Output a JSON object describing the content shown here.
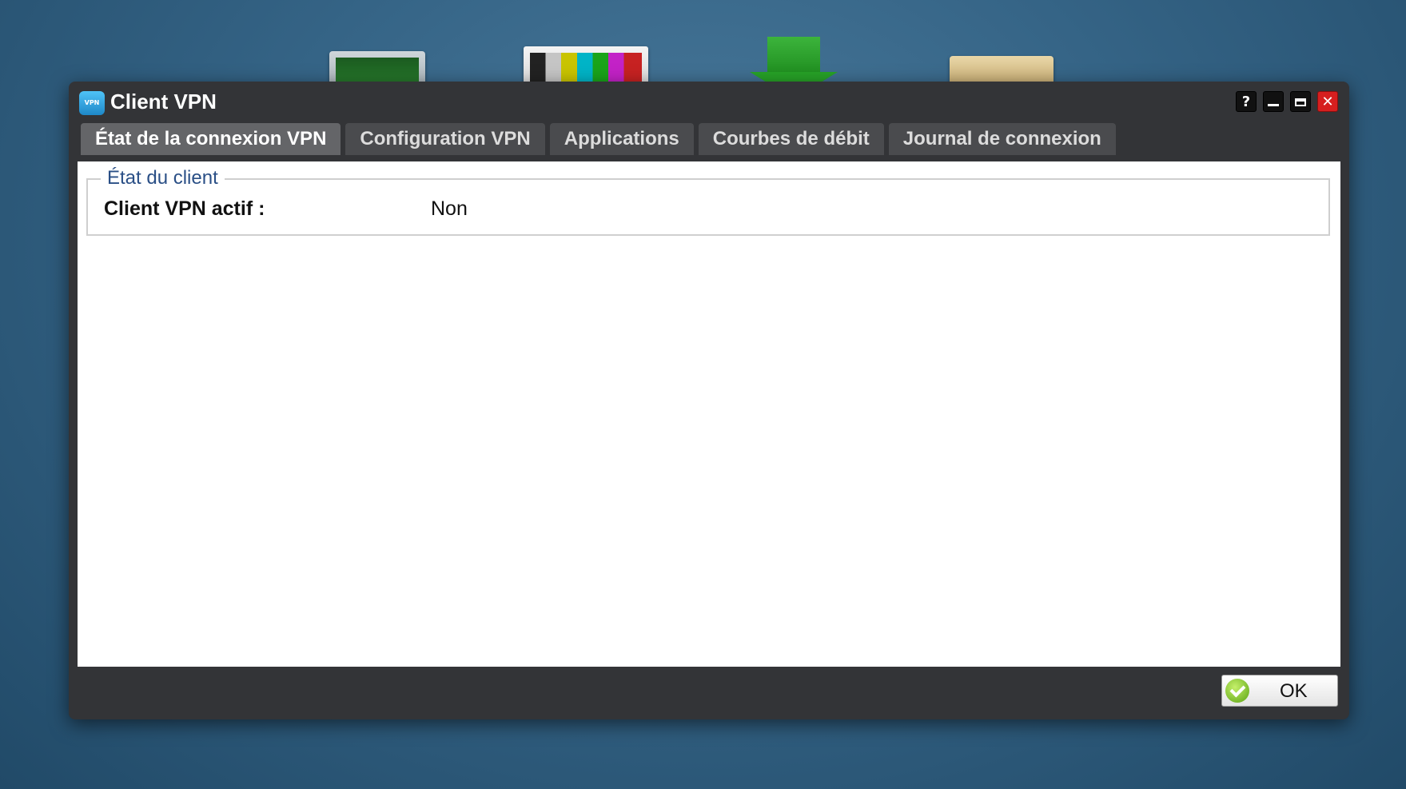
{
  "window": {
    "title": "Client VPN",
    "app_icon_text": "VPN",
    "buttons": {
      "help": "?"
    }
  },
  "tabs": [
    {
      "label": "État de la connexion VPN",
      "active": true
    },
    {
      "label": "Configuration VPN",
      "active": false
    },
    {
      "label": "Applications",
      "active": false
    },
    {
      "label": "Courbes de débit",
      "active": false
    },
    {
      "label": "Journal de connexion",
      "active": false
    }
  ],
  "client_status": {
    "legend": "État du client",
    "label": "Client VPN actif :",
    "value": "Non"
  },
  "footer": {
    "ok_label": "OK"
  },
  "colors": {
    "window_bg": "#333437",
    "tab_active": "#646568",
    "tab_inactive": "#4a4b4e",
    "legend_text": "#2a4f86",
    "close_button": "#d61f1f",
    "ok_check": "#5aa312"
  },
  "icons": [
    "vpn-app-icon",
    "help-icon",
    "minimize-icon",
    "maximize-icon",
    "close-icon",
    "check-icon"
  ]
}
